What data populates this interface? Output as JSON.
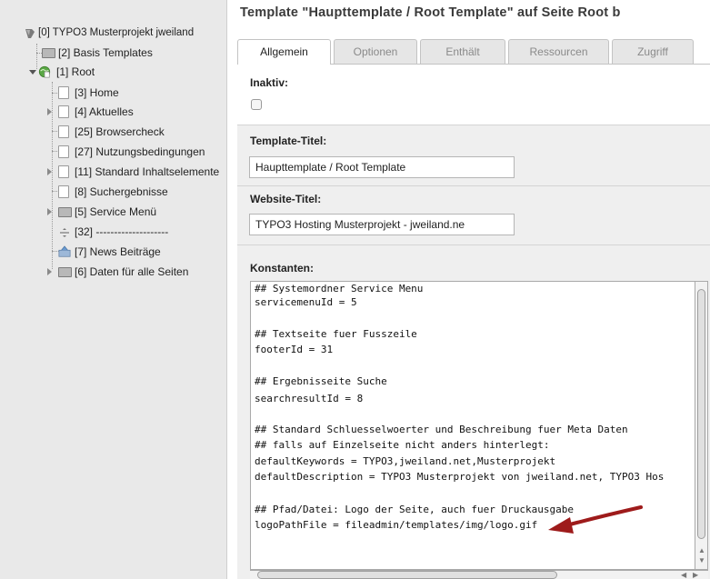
{
  "tree": {
    "root": "[0] TYPO3 Musterprojekt jweiland",
    "items": [
      {
        "label": "[2] Basis Templates"
      },
      {
        "label": "[1] Root"
      },
      {
        "label": "[3] Home"
      },
      {
        "label": "[4] Aktuelles"
      },
      {
        "label": "[25] Browsercheck"
      },
      {
        "label": "[27] Nutzungsbedingungen"
      },
      {
        "label": "[11] Standard Inhaltselemente"
      },
      {
        "label": "[8] Suchergebnisse"
      },
      {
        "label": "[5] Service Menü"
      },
      {
        "label": "[32] --------------------"
      },
      {
        "label": "[7] News Beiträge"
      },
      {
        "label": "[6] Daten für alle Seiten"
      }
    ]
  },
  "header": {
    "title": "Template \"Haupttemplate / Root Template\" auf Seite Root b"
  },
  "tabs": [
    {
      "label": "Allgemein"
    },
    {
      "label": "Optionen"
    },
    {
      "label": "Enthält"
    },
    {
      "label": "Ressourcen"
    },
    {
      "label": "Zugriff"
    }
  ],
  "form": {
    "inaktiv_label": "Inaktiv:",
    "template_title_label": "Template-Titel:",
    "template_title_value": "Haupttemplate / Root Template",
    "website_title_label": "Website-Titel:",
    "website_title_value": "TYPO3 Hosting Musterprojekt - jweiland.ne",
    "constants_label": "Konstanten:"
  },
  "constants_lines": [
    "## Systemordner Service Menu",
    "servicemenuId = 5",
    "",
    "## Textseite fuer Fusszeile",
    "footerId = 31",
    "",
    "## Ergebnisseite Suche",
    "searchresultId = 8",
    "",
    "## Standard Schluesselwoerter und Beschreibung fuer Meta Daten",
    "## falls auf Einzelseite nicht anders hinterlegt:",
    "defaultKeywords = TYPO3,jweiland.net,Musterprojekt",
    "defaultDescription = TYPO3 Musterprojekt von jweiland.net, TYPO3 Hos",
    "",
    "## Pfad/Datei: Logo der Seite, auch fuer Druckausgabe",
    "logoPathFile = fileadmin/templates/img/logo.gif"
  ],
  "colors": {
    "tree_bg": "#e9e9e9",
    "arrow": "#9e1b1b",
    "root_globe": "#4d9a3a"
  }
}
